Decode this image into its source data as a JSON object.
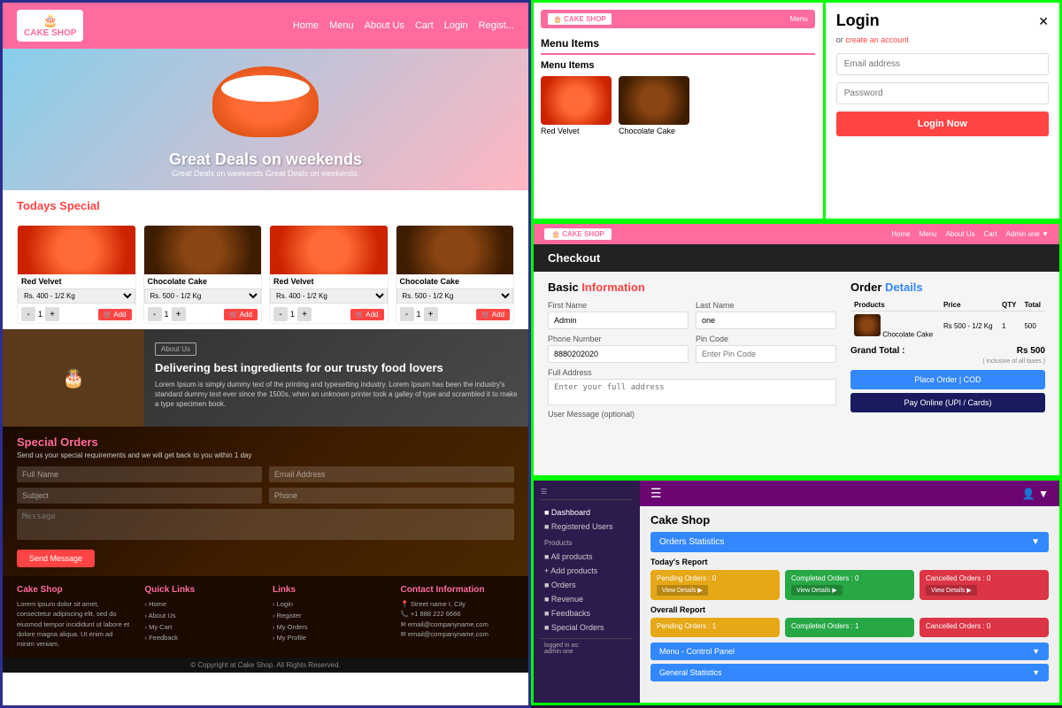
{
  "left": {
    "nav": {
      "logo": "CAKE SHOP",
      "links": [
        "Home",
        "Menu",
        "About Us",
        "Cart",
        "Login",
        "Regist..."
      ]
    },
    "hero": {
      "title": "Great Deals on weekends",
      "subtitle": "Great Deals on weekends Great Deals on weekends."
    },
    "todays_special": {
      "label": "Todays ",
      "label_colored": "Special",
      "cakes": [
        {
          "name": "Red Velvet",
          "price": "Rs. 400 - 1/2 Kg",
          "type": "red"
        },
        {
          "name": "Chocolate Cake",
          "price": "Rs. 500 - 1/2 Kg",
          "type": "choc"
        },
        {
          "name": "Red Velvet",
          "price": "Rs. 400 - 1/2 Kg",
          "type": "red"
        },
        {
          "name": "Chocolate Cake",
          "price": "Rs. 500 - 1/2 Kg",
          "type": "choc"
        }
      ]
    },
    "about": {
      "badge": "About Us",
      "heading": "Delivering best ingredients for our trusty food lovers",
      "body": "Lorem Ipsum is simply dummy text of the printing and typesetting industry. Lorem Ipsum has been the industry's standard dummy text ever since the 1500s, when an unknown printer took a galley of type and scrambled it to make a type specimen book."
    },
    "special_orders": {
      "title": "Special ",
      "title_colored": "Orders",
      "subtitle": "Send us your special requirements and we will get back to you within 1 day",
      "fields": {
        "full_name": "Full Name",
        "email": "Email Address",
        "subject": "Subject",
        "phone": "Phone",
        "message": "Message"
      },
      "send_btn": "Send Message"
    },
    "footer": {
      "col1": {
        "heading": "Cake Shop",
        "text": "Lorem ipsum dolor sit amet, consectetur adipiscing elit, sed do eiusmod tempor incididunt ut labore et dolore magna aliqua. Ut enim ad minim veniam."
      },
      "col2": {
        "heading": "Quick Links",
        "links": [
          "› Home",
          "› About Us",
          "› My Cart",
          "› Feedback"
        ]
      },
      "col3": {
        "heading": "Links",
        "links": [
          "› Login",
          "› Register",
          "› My Orders",
          "› My Profile"
        ]
      },
      "col4": {
        "heading": "Contact Information",
        "lines": [
          "📍 Street name I, City",
          "📞 +1 888 222 6666",
          "✉ email@companyname.com",
          "✉ email@companyname.com"
        ]
      }
    },
    "footer_bottom": "© Copyright at Cake Shop. All Rights Reserved."
  },
  "top_right": {
    "menu": {
      "logo": "CAKE SHOP",
      "nav_links": [
        "Menu"
      ],
      "heading": "Menu Items",
      "subheading": "Menu Items",
      "cakes": [
        {
          "name": "Red Velvet",
          "type": "red"
        },
        {
          "name": "Chocolate Cake",
          "type": "choc"
        }
      ]
    },
    "login": {
      "title": "Login",
      "subtitle": "or ",
      "create_account": "create an account",
      "email_placeholder": "Email address",
      "password_placeholder": "Password",
      "btn_label": "Login Now"
    }
  },
  "middle_right": {
    "nav": {
      "logo": "CAKE SHOP",
      "links": [
        "Home",
        "Menu",
        "About Us",
        "Cart",
        "Admin one ▼"
      ]
    },
    "header": "Checkout",
    "basic_info": {
      "title": "Basic ",
      "title_colored": "Information",
      "first_name_label": "First Name",
      "first_name_value": "Admin",
      "last_name_label": "Last Name",
      "last_name_value": "one",
      "phone_label": "Phone Number",
      "phone_value": "8880202020",
      "pin_label": "Pin Code",
      "pin_placeholder": "Enter Pin Code",
      "address_label": "Full Address",
      "address_placeholder": "Enter your full address",
      "message_label": "User Message (optional)"
    },
    "order_details": {
      "title": "Order ",
      "title_colored": "Details",
      "headers": [
        "Products",
        "Price",
        "QTY",
        "Total"
      ],
      "item": {
        "name": "Chocolate Cake",
        "price": "Rs 500 - 1/2 Kg",
        "qty": 1,
        "total": 500
      },
      "grand_total_label": "Grand Total :",
      "grand_total_value": "Rs 500",
      "note": "( inclusive of all taxes )",
      "place_order_btn": "Place Order | COD",
      "pay_online_btn": "Pay Online (UPI / Cards)"
    }
  },
  "bottom_right": {
    "sidebar": {
      "items": [
        {
          "label": "Dashboard",
          "icon": "■",
          "active": true
        },
        {
          "label": "Registered Users",
          "icon": "■"
        },
        {
          "label": "Products",
          "icon": "■"
        },
        {
          "label": "All products",
          "icon": "■",
          "sub": true
        },
        {
          "label": "+ Add products",
          "icon": "+"
        },
        {
          "label": "Orders",
          "icon": "■"
        },
        {
          "label": "Revenue",
          "icon": "■"
        },
        {
          "label": "Feedbacks",
          "icon": "■"
        },
        {
          "label": "Special Orders",
          "icon": "■"
        },
        {
          "label": "logged in as: admin one",
          "icon": ""
        }
      ]
    },
    "admin_bar": {
      "hamburger": "☰",
      "title": "Cake Shop",
      "user_icon": "👤"
    },
    "main": {
      "shop_title": "Cake Shop",
      "accordion_label": "Orders Statistics",
      "todays_report": "Today's Report",
      "today_cards": [
        {
          "label": "Pending Orders : 0",
          "btn": "View Details",
          "color": "yellow"
        },
        {
          "label": "Completed Orders : 0",
          "btn": "View Details",
          "color": "green"
        },
        {
          "label": "Cancelled Orders : 0",
          "btn": "View Details",
          "color": "red"
        }
      ],
      "overall_report": "Overall Report",
      "overall_cards": [
        {
          "label": "Pending Orders : 1",
          "color": "yellow"
        },
        {
          "label": "Completed Orders : 1",
          "color": "green"
        },
        {
          "label": "Cancelled Orders : 0",
          "color": "red"
        }
      ],
      "panel_btn": "Menu - Control Panel",
      "stats_btn": "General Statistics"
    }
  }
}
